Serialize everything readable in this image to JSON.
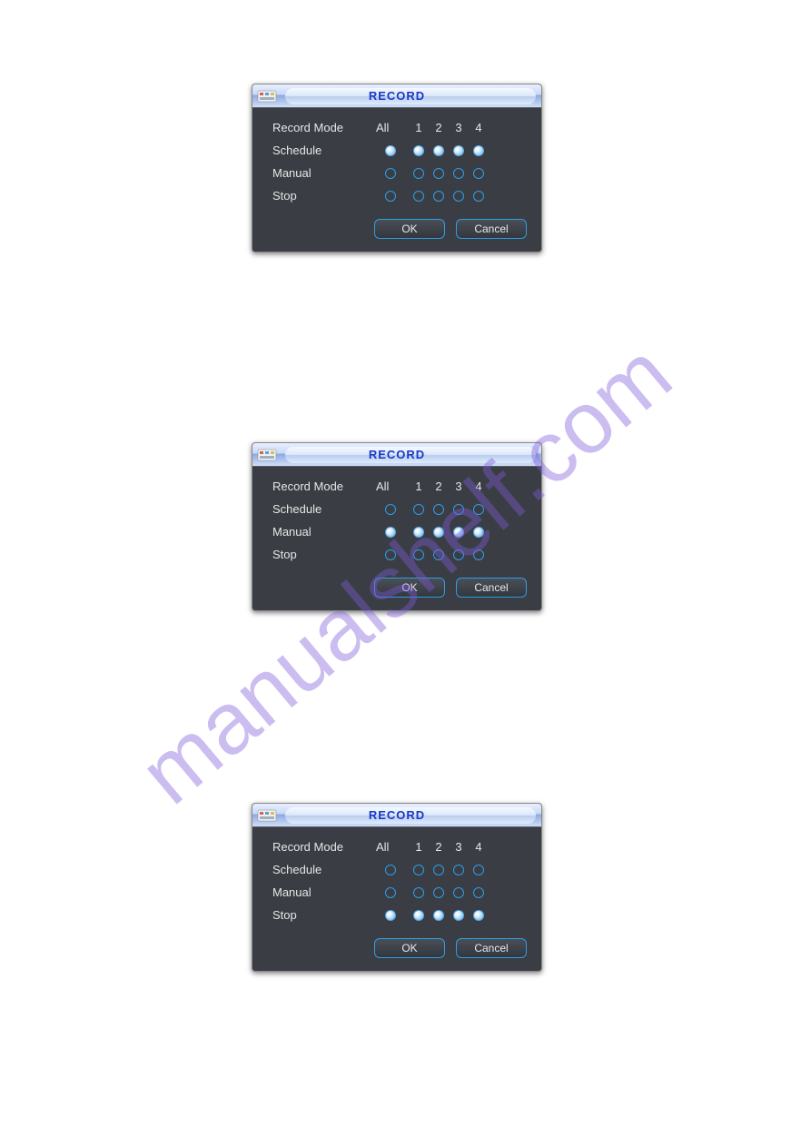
{
  "watermark": "manualshelf.com",
  "dialogs": [
    {
      "title": "RECORD",
      "header": {
        "mode": "Record Mode",
        "all": "All",
        "c1": "1",
        "c2": "2",
        "c3": "3",
        "c4": "4"
      },
      "rows": [
        {
          "label": "Schedule",
          "sel": [
            true,
            true,
            true,
            true,
            true
          ]
        },
        {
          "label": "Manual",
          "sel": [
            false,
            false,
            false,
            false,
            false
          ]
        },
        {
          "label": "Stop",
          "sel": [
            false,
            false,
            false,
            false,
            false
          ]
        }
      ],
      "buttons": {
        "ok": "OK",
        "cancel": "Cancel"
      }
    },
    {
      "title": "RECORD",
      "header": {
        "mode": "Record Mode",
        "all": "All",
        "c1": "1",
        "c2": "2",
        "c3": "3",
        "c4": "4"
      },
      "rows": [
        {
          "label": "Schedule",
          "sel": [
            false,
            false,
            false,
            false,
            false
          ]
        },
        {
          "label": "Manual",
          "sel": [
            true,
            true,
            true,
            true,
            true
          ]
        },
        {
          "label": "Stop",
          "sel": [
            false,
            false,
            false,
            false,
            false
          ]
        }
      ],
      "buttons": {
        "ok": "OK",
        "cancel": "Cancel"
      }
    },
    {
      "title": "RECORD",
      "header": {
        "mode": "Record Mode",
        "all": "All",
        "c1": "1",
        "c2": "2",
        "c3": "3",
        "c4": "4"
      },
      "rows": [
        {
          "label": "Schedule",
          "sel": [
            false,
            false,
            false,
            false,
            false
          ]
        },
        {
          "label": "Manual",
          "sel": [
            false,
            false,
            false,
            false,
            false
          ]
        },
        {
          "label": "Stop",
          "sel": [
            true,
            true,
            true,
            true,
            true
          ]
        }
      ],
      "buttons": {
        "ok": "OK",
        "cancel": "Cancel"
      }
    }
  ]
}
